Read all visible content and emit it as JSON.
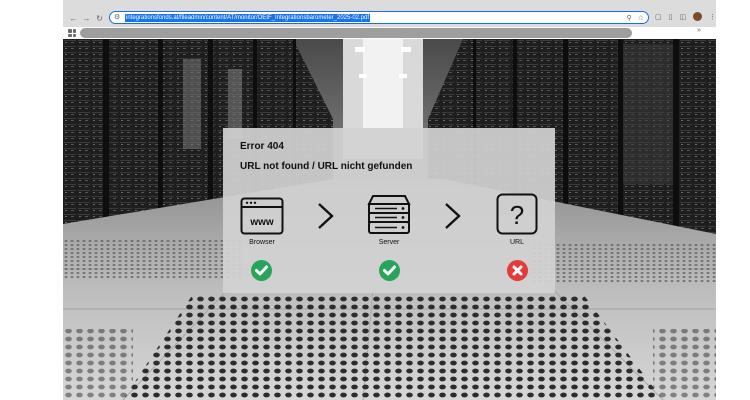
{
  "browser": {
    "url": "integrationsfonds.at/fileadmin/content/AT/monitor/OEIF_Integrationsbarometer_2025-02.pdf"
  },
  "error": {
    "title": "Error 404",
    "message": "URL not found / URL nicht gefunden",
    "steps": [
      {
        "label": "Browser",
        "icon": "browser-window-icon",
        "status": "success",
        "status_icon": "check-icon"
      },
      {
        "label": "Server",
        "icon": "server-stack-icon",
        "status": "success",
        "status_icon": "check-icon"
      },
      {
        "label": "URL",
        "icon": "question-mark-icon",
        "status": "error",
        "status_icon": "x-icon"
      }
    ],
    "colors": {
      "success": "#27a55a",
      "error": "#e23b3b"
    }
  }
}
